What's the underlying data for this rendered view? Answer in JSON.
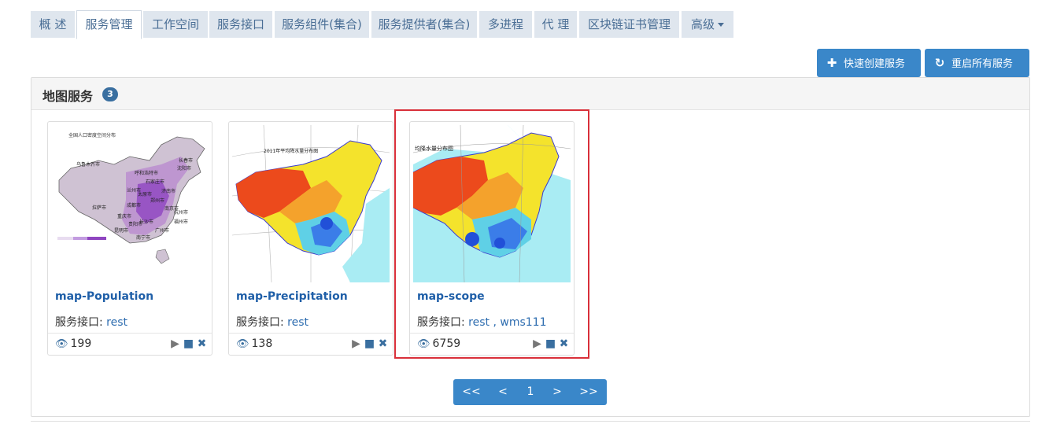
{
  "tabs": [
    {
      "label": "概 述"
    },
    {
      "label": "服务管理"
    },
    {
      "label": "工作空间"
    },
    {
      "label": "服务接口"
    },
    {
      "label": "服务组件(集合)"
    },
    {
      "label": "服务提供者(集合)"
    },
    {
      "label": "多进程"
    },
    {
      "label": "代 理"
    },
    {
      "label": "区块链证书管理"
    },
    {
      "label": "高级"
    }
  ],
  "toolbar": {
    "quick_create_label": "快速创建服务",
    "quick_create_icon": "plus-icon",
    "restart_all_label": "重启所有服务",
    "restart_all_icon": "refresh-icon"
  },
  "panel": {
    "title": "地图服务",
    "count": "3"
  },
  "cards": [
    {
      "name": "map-Population",
      "interface_label": "服务接口:",
      "interfaces": "rest",
      "views": "199",
      "map_title": "全国人口密度空间分布",
      "cities": [
        "乌鲁木齐市",
        "呼和浩特市",
        "长春市",
        "沈阳市",
        "石家庄市",
        "兰州市",
        "太原市",
        "济南市",
        "郑州市",
        "拉萨市",
        "成都市",
        "南京市",
        "重庆市",
        "杭州市",
        "长沙市",
        "福州市",
        "广州市",
        "南宁市",
        "昆明市",
        "贵阳市"
      ]
    },
    {
      "name": "map-Precipitation",
      "interface_label": "服务接口:",
      "interfaces": "rest",
      "views": "138",
      "map_title": "2011年平均降水量分布图"
    },
    {
      "name": "map-scope",
      "interface_label": "服务接口:",
      "interfaces": "rest , wms111",
      "views": "6759",
      "map_title": "均降水量分布图"
    }
  ],
  "pagination": {
    "first": "<<",
    "prev": "<",
    "current": "1",
    "next": ">",
    "last": ">>"
  },
  "colors": {
    "accent": "#3a87c9",
    "tab_bg": "#dfe6ee",
    "highlight": "#d9303a",
    "link": "#1f5fa8"
  }
}
